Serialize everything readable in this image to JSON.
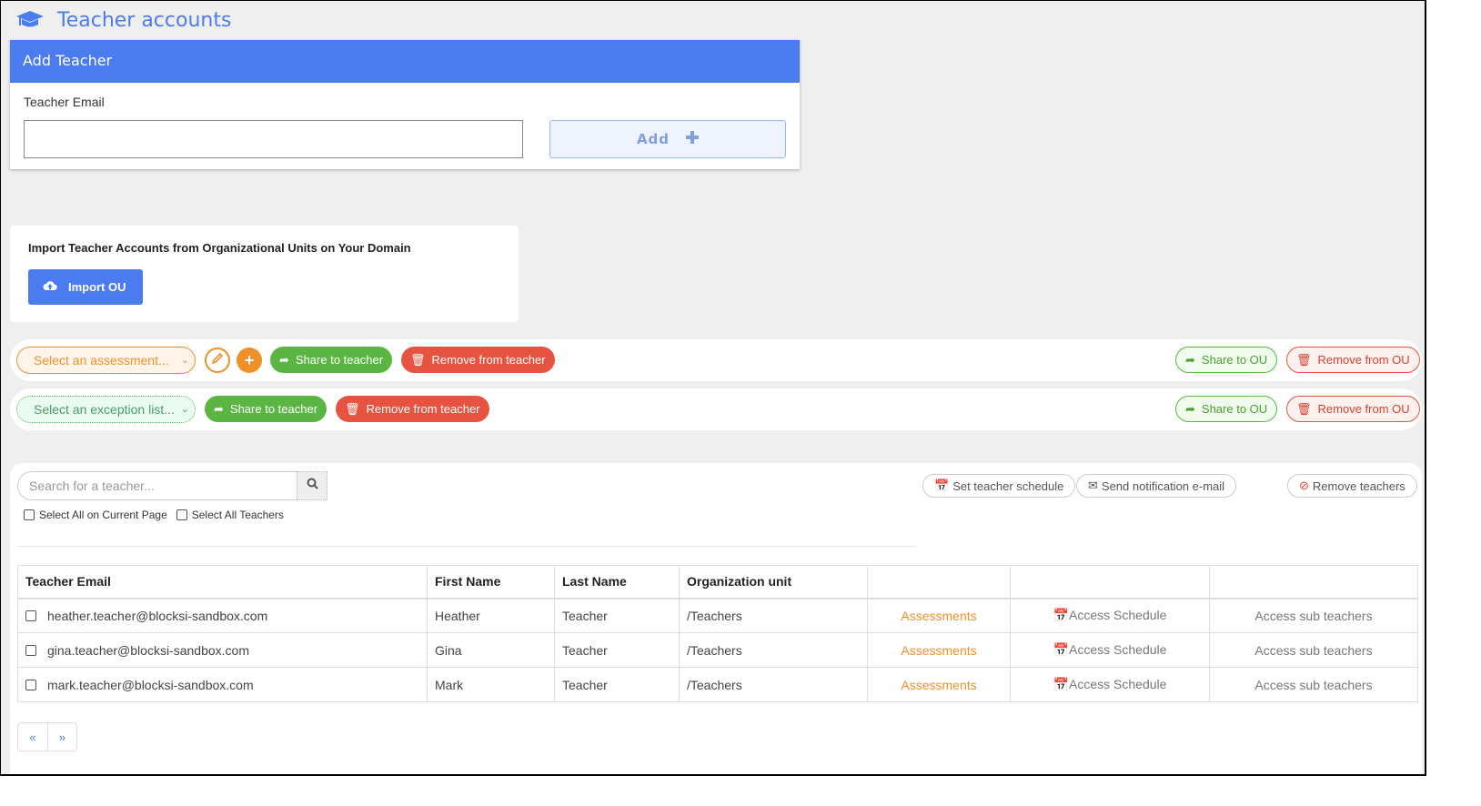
{
  "page": {
    "title": "Teacher accounts",
    "title_icon": "graduation-cap-icon",
    "accent": "#4a7ded"
  },
  "add_teacher": {
    "header": "Add Teacher",
    "email_label": "Teacher Email",
    "email_value": "",
    "add_label": "Add",
    "add_icon": "plus-icon"
  },
  "import": {
    "heading": "Import Teacher Accounts from Organizational Units on Your Domain",
    "button_label": "Import OU",
    "button_icon": "cloud-upload-icon"
  },
  "assessment_bar": {
    "select_placeholder": "Select an assessment...",
    "share_teacher": "Share to teacher",
    "remove_teacher": "Remove from teacher",
    "share_ou": "Share to OU",
    "remove_ou": "Remove from OU"
  },
  "exception_bar": {
    "select_placeholder": "Select an exception list...",
    "share_teacher": "Share to teacher",
    "remove_teacher": "Remove from teacher",
    "share_ou": "Share to OU",
    "remove_ou": "Remove from OU"
  },
  "teachers": {
    "search_placeholder": "Search for a teacher...",
    "select_all_page": "Select All on Current Page",
    "select_all_teachers": "Select All Teachers",
    "set_schedule": "Set teacher schedule",
    "send_email": "Send notification e-mail",
    "remove_teachers": "Remove teachers",
    "columns": [
      "Teacher Email",
      "First Name",
      "Last Name",
      "Organization unit",
      "",
      "",
      ""
    ],
    "rows": [
      {
        "email": "heather.teacher@blocksi-sandbox.com",
        "first": "Heather",
        "last": "Teacher",
        "ou": "/Teachers",
        "assess": "Assessments",
        "schedule": "Access Schedule",
        "sub": "Access sub teachers"
      },
      {
        "email": "gina.teacher@blocksi-sandbox.com",
        "first": "Gina",
        "last": "Teacher",
        "ou": "/Teachers",
        "assess": "Assessments",
        "schedule": "Access Schedule",
        "sub": "Access sub teachers"
      },
      {
        "email": "mark.teacher@blocksi-sandbox.com",
        "first": "Mark",
        "last": "Teacher",
        "ou": "/Teachers",
        "assess": "Assessments",
        "schedule": "Access Schedule",
        "sub": "Access sub teachers"
      }
    ],
    "pager_prev": "«",
    "pager_next": "»"
  }
}
